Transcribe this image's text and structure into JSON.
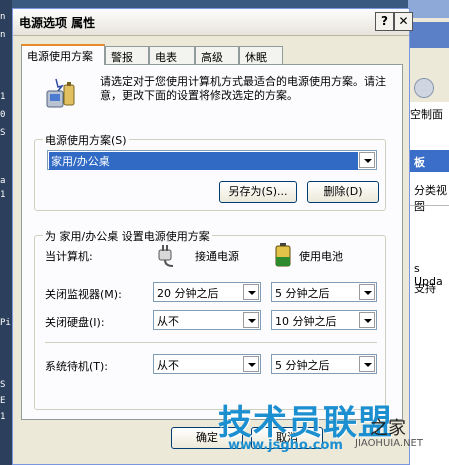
{
  "background": {
    "left_chars": [
      "n",
      "n",
      "1",
      "0",
      "S",
      "a",
      "1",
      "Pi",
      "S",
      "E",
      "1"
    ],
    "right_window": {
      "title": "",
      "address_text": "空制面板",
      "header_text": "板",
      "item1": "分类视图",
      "item2": "s Upda",
      "item3": "支持"
    }
  },
  "dialog": {
    "title": "电源选项 属性",
    "help_button": "?",
    "close_button": "✕",
    "tabs": [
      "电源使用方案",
      "警报",
      "电表",
      "高级",
      "休眠"
    ],
    "active_tab": 0,
    "intro_text": "请选定对于您使用计算机方式最适合的电源使用方案。请注意，更改下面的设置将修改选定的方案。",
    "scheme_group": {
      "label": "电源使用方案(S)",
      "selected": "家用/办公桌",
      "save_as": "另存为(S)...",
      "delete": "删除(D)"
    },
    "settings_group": {
      "label": "为 家用/办公桌 设置电源使用方案",
      "computer_label": "当计算机:",
      "ac_label": "接通电源",
      "dc_label": "使用电池",
      "rows": [
        {
          "label": "关闭监视器(M):",
          "ac": "20 分钟之后",
          "dc": "5 分钟之后"
        },
        {
          "label": "关闭硬盘(I):",
          "ac": "从不",
          "dc": "10 分钟之后"
        },
        {
          "label": "系统待机(T):",
          "ac": "从不",
          "dc": "5 分钟之后"
        }
      ]
    },
    "ok_button": "确定",
    "cancel_button": "取消"
  },
  "watermark": {
    "brand": "技术员联盟",
    "url": "www.jsgho.com",
    "suffix": "之家",
    "suffix_url": "JIAOHUIA.NET"
  },
  "colors": {
    "selection": "#316ac5",
    "active_tab_accent": "#e68b2c",
    "watermark": "#1b8fd0"
  }
}
